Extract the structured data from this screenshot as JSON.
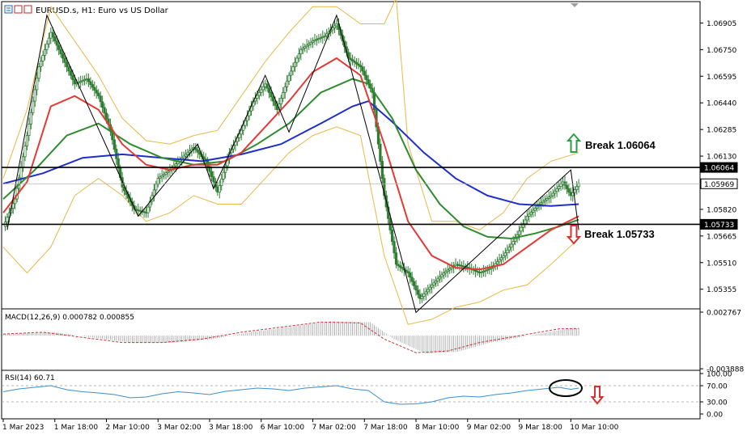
{
  "header": {
    "title": "EURUSD.s, H1:  Euro vs US Dollar"
  },
  "colors": {
    "candle": "#2e7d32",
    "ma_red": "#e53935",
    "ma_green": "#2e8b2e",
    "ma_blue": "#1e2ecc",
    "bollinger": "#e8b84a",
    "rsi": "#3a8fd1",
    "macd_signal": "#d32f2f",
    "macd_hist": "#a0a0a0",
    "up_arrow": "#2e9e44",
    "down_arrow": "#d93030"
  },
  "chart_data": {
    "type": "line",
    "main": {
      "ylim": [
        1.0525,
        1.0702
      ],
      "ticks": [
        "1.06905",
        "1.06750",
        "1.06595",
        "1.06440",
        "1.06285",
        "1.06130",
        "1.05820",
        "1.05665",
        "1.05510",
        "1.05355"
      ],
      "tick_values": [
        1.06905,
        1.0675,
        1.06595,
        1.0644,
        1.06285,
        1.0613,
        1.0582,
        1.05665,
        1.0551,
        1.05355
      ],
      "level_labels": [
        "1.06064",
        "1.05969",
        "1.05733"
      ],
      "level_values": [
        1.06064,
        1.05969,
        1.05733
      ],
      "annotations": {
        "break_up": "Break 1.06064",
        "break_down": "Break 1.05733"
      },
      "price_series": [
        [
          0,
          1.0572
        ],
        [
          3,
          1.0588
        ],
        [
          6,
          1.0625
        ],
        [
          9,
          1.0665
        ],
        [
          12,
          1.0685
        ],
        [
          15,
          1.067
        ],
        [
          18,
          1.0655
        ],
        [
          21,
          1.0658
        ],
        [
          24,
          1.0648
        ],
        [
          27,
          1.0628
        ],
        [
          30,
          1.0595
        ],
        [
          33,
          1.0582
        ],
        [
          36,
          1.058
        ],
        [
          39,
          1.06
        ],
        [
          42,
          1.0605
        ],
        [
          45,
          1.0612
        ],
        [
          48,
          1.0618
        ],
        [
          51,
          1.061
        ],
        [
          54,
          1.0592
        ],
        [
          57,
          1.0615
        ],
        [
          60,
          1.0628
        ],
        [
          63,
          1.0645
        ],
        [
          66,
          1.0655
        ],
        [
          69,
          1.064
        ],
        [
          72,
          1.066
        ],
        [
          75,
          1.0675
        ],
        [
          78,
          1.068
        ],
        [
          81,
          1.0683
        ],
        [
          84,
          1.069
        ],
        [
          87,
          1.067
        ],
        [
          90,
          1.0665
        ],
        [
          93,
          1.065
        ],
        [
          96,
          1.059
        ],
        [
          99,
          1.055
        ],
        [
          102,
          1.0545
        ],
        [
          105,
          1.053
        ],
        [
          108,
          1.0538
        ],
        [
          111,
          1.0545
        ],
        [
          114,
          1.055
        ],
        [
          117,
          1.0548
        ],
        [
          120,
          1.0545
        ],
        [
          123,
          1.0548
        ],
        [
          126,
          1.0555
        ],
        [
          129,
          1.0565
        ],
        [
          132,
          1.0578
        ],
        [
          135,
          1.0585
        ],
        [
          138,
          1.059
        ],
        [
          141,
          1.0598
        ],
        [
          143,
          1.059
        ],
        [
          145,
          1.0597
        ]
      ],
      "ma_red": [
        [
          0,
          1.058
        ],
        [
          6,
          1.0598
        ],
        [
          12,
          1.0642
        ],
        [
          18,
          1.0648
        ],
        [
          24,
          1.064
        ],
        [
          30,
          1.062
        ],
        [
          36,
          1.0608
        ],
        [
          42,
          1.0605
        ],
        [
          48,
          1.0608
        ],
        [
          54,
          1.0608
        ],
        [
          60,
          1.0615
        ],
        [
          66,
          1.063
        ],
        [
          72,
          1.0645
        ],
        [
          78,
          1.0662
        ],
        [
          84,
          1.067
        ],
        [
          90,
          1.066
        ],
        [
          96,
          1.062
        ],
        [
          102,
          1.0575
        ],
        [
          108,
          1.0555
        ],
        [
          114,
          1.0548
        ],
        [
          120,
          1.0547
        ],
        [
          126,
          1.055
        ],
        [
          132,
          1.056
        ],
        [
          138,
          1.057
        ],
        [
          145,
          1.0578
        ]
      ],
      "ma_green": [
        [
          0,
          1.0588
        ],
        [
          8,
          1.0605
        ],
        [
          16,
          1.0625
        ],
        [
          24,
          1.0632
        ],
        [
          32,
          1.062
        ],
        [
          40,
          1.0612
        ],
        [
          48,
          1.0608
        ],
        [
          56,
          1.061
        ],
        [
          64,
          1.062
        ],
        [
          72,
          1.0632
        ],
        [
          80,
          1.065
        ],
        [
          88,
          1.0658
        ],
        [
          92,
          1.0655
        ],
        [
          98,
          1.0635
        ],
        [
          104,
          1.0605
        ],
        [
          110,
          1.0585
        ],
        [
          116,
          1.0572
        ],
        [
          122,
          1.0566
        ],
        [
          128,
          1.0565
        ],
        [
          134,
          1.0568
        ],
        [
          140,
          1.0572
        ],
        [
          145,
          1.0576
        ]
      ],
      "ma_blue": [
        [
          0,
          1.0597
        ],
        [
          10,
          1.0603
        ],
        [
          20,
          1.0612
        ],
        [
          30,
          1.0614
        ],
        [
          40,
          1.0612
        ],
        [
          50,
          1.061
        ],
        [
          60,
          1.0614
        ],
        [
          70,
          1.062
        ],
        [
          80,
          1.0632
        ],
        [
          88,
          1.0642
        ],
        [
          92,
          1.0645
        ],
        [
          98,
          1.0633
        ],
        [
          106,
          1.0615
        ],
        [
          114,
          1.06
        ],
        [
          122,
          1.059
        ],
        [
          130,
          1.0585
        ],
        [
          138,
          1.0584
        ],
        [
          145,
          1.0585
        ]
      ],
      "bb_upper": [
        [
          0,
          1.06
        ],
        [
          6,
          1.064
        ],
        [
          12,
          1.07
        ],
        [
          18,
          1.068
        ],
        [
          24,
          1.066
        ],
        [
          30,
          1.0635
        ],
        [
          36,
          1.0622
        ],
        [
          42,
          1.062
        ],
        [
          48,
          1.0625
        ],
        [
          54,
          1.0628
        ],
        [
          60,
          1.0648
        ],
        [
          66,
          1.0668
        ],
        [
          72,
          1.0685
        ],
        [
          78,
          1.07
        ],
        [
          84,
          1.07
        ],
        [
          90,
          1.069
        ],
        [
          96,
          1.069
        ],
        [
          99,
          1.0705
        ],
        [
          102,
          1.062
        ],
        [
          108,
          1.0575
        ],
        [
          114,
          1.0575
        ],
        [
          120,
          1.057
        ],
        [
          126,
          1.058
        ],
        [
          132,
          1.06
        ],
        [
          138,
          1.061
        ],
        [
          145,
          1.0615
        ]
      ],
      "bb_lower": [
        [
          0,
          1.056
        ],
        [
          6,
          1.0545
        ],
        [
          12,
          1.056
        ],
        [
          18,
          1.059
        ],
        [
          24,
          1.06
        ],
        [
          30,
          1.059
        ],
        [
          36,
          1.0575
        ],
        [
          42,
          1.058
        ],
        [
          48,
          1.059
        ],
        [
          54,
          1.0585
        ],
        [
          60,
          1.0585
        ],
        [
          66,
          1.06
        ],
        [
          72,
          1.0615
        ],
        [
          78,
          1.0625
        ],
        [
          84,
          1.063
        ],
        [
          90,
          1.0625
        ],
        [
          96,
          1.0555
        ],
        [
          102,
          1.0515
        ],
        [
          108,
          1.0518
        ],
        [
          114,
          1.0525
        ],
        [
          120,
          1.0528
        ],
        [
          126,
          1.0535
        ],
        [
          132,
          1.0538
        ],
        [
          138,
          1.055
        ],
        [
          145,
          1.0565
        ]
      ],
      "zigzag": [
        [
          1,
          1.057
        ],
        [
          11,
          1.0695
        ],
        [
          34,
          1.0578
        ],
        [
          49,
          1.062
        ],
        [
          53,
          1.0594
        ],
        [
          66,
          1.066
        ],
        [
          72,
          1.0627
        ],
        [
          84,
          1.0695
        ],
        [
          95,
          1.06
        ],
        [
          104,
          1.0522
        ],
        [
          143,
          1.0605
        ],
        [
          145,
          1.057
        ]
      ]
    },
    "macd": {
      "label": "MACD(12,26,9) 0.000782 0.000855",
      "ylim": [
        -0.00388,
        0.00277
      ],
      "ticks": [
        "0.002767",
        "-0.003888"
      ],
      "tick_values": [
        0.002767,
        -0.003888
      ],
      "signal": [
        [
          0,
          0.0002
        ],
        [
          10,
          0.0004
        ],
        [
          20,
          -0.0002
        ],
        [
          30,
          -0.0008
        ],
        [
          40,
          -0.0008
        ],
        [
          50,
          -0.0004
        ],
        [
          60,
          0.0004
        ],
        [
          70,
          0.001
        ],
        [
          80,
          0.0016
        ],
        [
          90,
          0.0015
        ],
        [
          96,
          -0.0004
        ],
        [
          104,
          -0.002
        ],
        [
          112,
          -0.0018
        ],
        [
          120,
          -0.0008
        ],
        [
          130,
          0.0
        ],
        [
          140,
          0.0008
        ],
        [
          145,
          0.00085
        ]
      ]
    },
    "rsi": {
      "label": "RSI(14) 60.71",
      "ylim": [
        0,
        100
      ],
      "ticks": [
        "100.00",
        "70.00",
        "30.00",
        "0.00"
      ],
      "tick_values": [
        100,
        70,
        30,
        0
      ],
      "values": [
        [
          0,
          55
        ],
        [
          4,
          62
        ],
        [
          8,
          66
        ],
        [
          12,
          70
        ],
        [
          16,
          60
        ],
        [
          20,
          55
        ],
        [
          24,
          52
        ],
        [
          28,
          48
        ],
        [
          32,
          40
        ],
        [
          36,
          42
        ],
        [
          40,
          50
        ],
        [
          44,
          55
        ],
        [
          48,
          52
        ],
        [
          52,
          48
        ],
        [
          56,
          56
        ],
        [
          60,
          60
        ],
        [
          64,
          64
        ],
        [
          68,
          62
        ],
        [
          72,
          58
        ],
        [
          76,
          64
        ],
        [
          80,
          67
        ],
        [
          84,
          70
        ],
        [
          88,
          62
        ],
        [
          92,
          58
        ],
        [
          96,
          30
        ],
        [
          100,
          24
        ],
        [
          104,
          25
        ],
        [
          108,
          30
        ],
        [
          112,
          40
        ],
        [
          116,
          44
        ],
        [
          120,
          42
        ],
        [
          124,
          48
        ],
        [
          128,
          52
        ],
        [
          132,
          58
        ],
        [
          136,
          62
        ],
        [
          140,
          66
        ],
        [
          143,
          61
        ],
        [
          145,
          64
        ]
      ]
    },
    "x_labels": [
      "1 Mar 2023",
      "1 Mar 18:00",
      "2 Mar 10:00",
      "3 Mar 02:00",
      "3 Mar 18:00",
      "6 Mar 10:00",
      "7 Mar 02:00",
      "7 Mar 18:00",
      "8 Mar 10:00",
      "9 Mar 02:00",
      "9 Mar 18:00",
      "10 Mar 10:00"
    ],
    "x_label_positions": [
      0,
      13,
      26,
      39,
      52,
      65,
      78,
      91,
      104,
      117,
      130,
      143
    ],
    "xlim": [
      0,
      146
    ],
    "grid": false
  }
}
